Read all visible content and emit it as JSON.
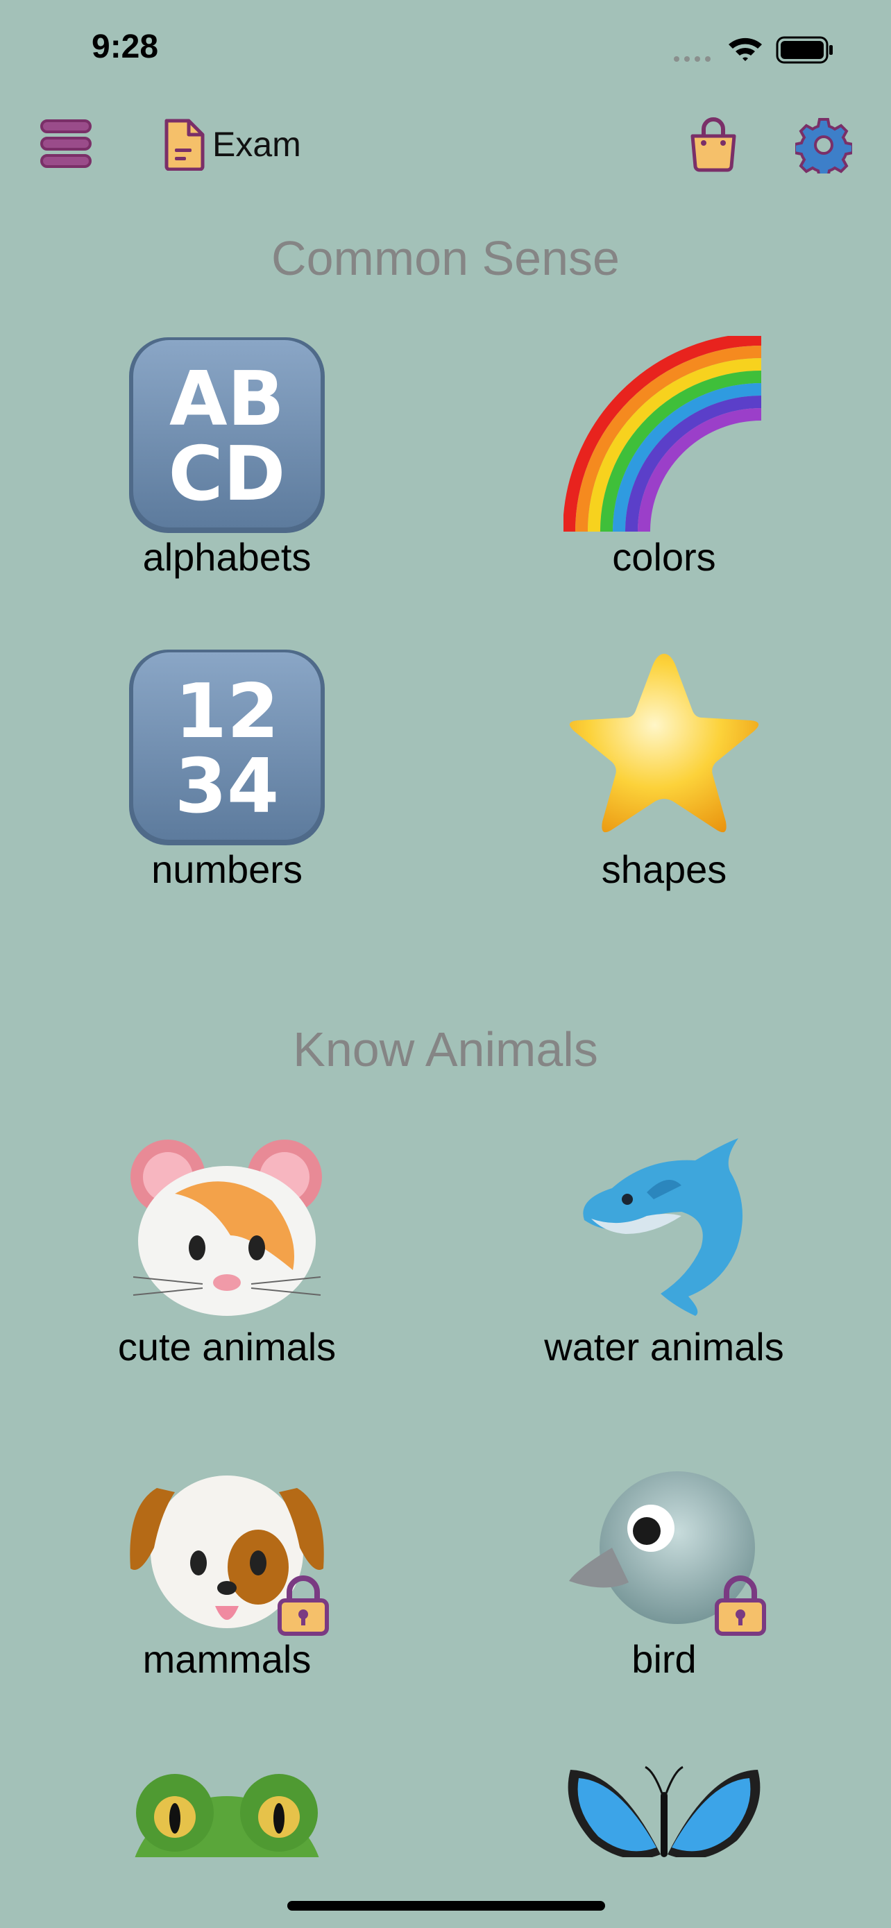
{
  "status_bar": {
    "time": "9:28"
  },
  "nav": {
    "exam_label": "Exam",
    "menu_icon": "hamburger-menu-icon",
    "exam_icon": "document-icon",
    "shop_icon": "shopping-bag-icon",
    "settings_icon": "gear-icon"
  },
  "colors": {
    "background": "#a3c1b8",
    "accent_purple": "#7a3a82",
    "accent_yellow": "#f5c86a",
    "section_title": "#858585",
    "gear_blue": "#3d7fc9"
  },
  "sections": [
    {
      "title": "Common Sense",
      "items": [
        {
          "label": "alphabets",
          "icon": "abcd-keycap-icon",
          "locked": false
        },
        {
          "label": "colors",
          "icon": "rainbow-icon",
          "locked": false
        },
        {
          "label": "numbers",
          "icon": "1234-keycap-icon",
          "locked": false
        },
        {
          "label": "shapes",
          "icon": "star-icon",
          "locked": false
        }
      ]
    },
    {
      "title": "Know Animals",
      "items": [
        {
          "label": "cute animals",
          "icon": "hamster-icon",
          "locked": false
        },
        {
          "label": "water animals",
          "icon": "dolphin-icon",
          "locked": false
        },
        {
          "label": "mammals",
          "icon": "dog-icon",
          "locked": true
        },
        {
          "label": "bird",
          "icon": "bird-icon",
          "locked": true
        },
        {
          "label": "",
          "icon": "frog-icon",
          "locked": false
        },
        {
          "label": "",
          "icon": "butterfly-icon",
          "locked": false
        }
      ]
    }
  ]
}
